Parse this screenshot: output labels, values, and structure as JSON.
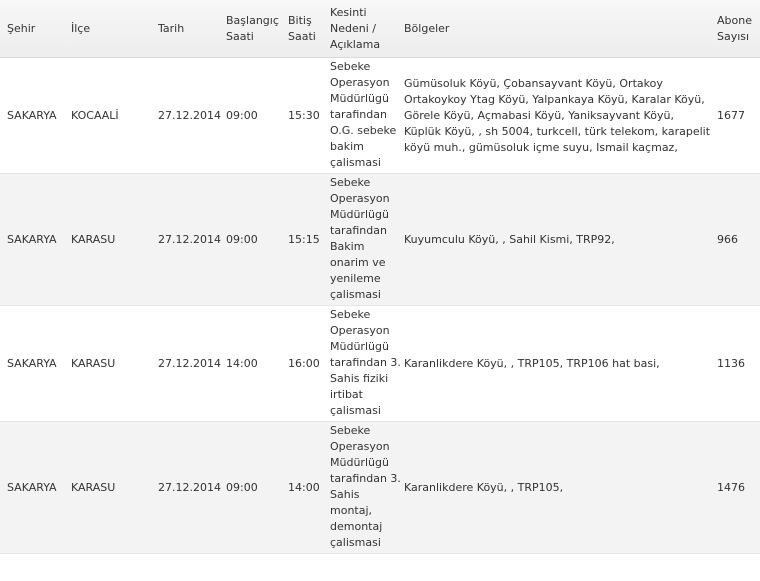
{
  "columns": {
    "city": "Şehir",
    "district": "İlçe",
    "date": "Tarih",
    "start": "Başlangıç Saati",
    "end": "Bitiş Saati",
    "reason": "Kesinti Nedeni / Açıklama",
    "regions": "Bölgeler",
    "subscribers": "Abone Sayısı"
  },
  "rows": [
    {
      "city": "SAKARYA",
      "district": "KOCAALİ",
      "date": "27.12.2014",
      "start": "09:00",
      "end": "15:30",
      "reason": "Sebeke Operasyon Müdürlügü tarafindan O.G. sebeke bakim çalismasi",
      "regions": "Gümüsoluk Köyü, Çobansayvant Köyü, Ortakoy Ortakoykoy Ytag Köyü, Yalpankaya Köyü, Karalar Köyü, Görele Köyü, Açmabasi Köyü, Yaniksayvant Köyü, Küplük Köyü, , sh 5004, turkcell, türk telekom, karapelit köyü muh., gümüsoluk içme suyu, Ismail kaçmaz,",
      "subscribers": "1677"
    },
    {
      "city": "SAKARYA",
      "district": "KARASU",
      "date": "27.12.2014",
      "start": "09:00",
      "end": "15:15",
      "reason": "Sebeke Operasyon Müdürlügü tarafindan Bakim onarim ve yenileme çalismasi",
      "regions": "Kuyumculu Köyü, , Sahil Kismi, TRP92,",
      "subscribers": "966"
    },
    {
      "city": "SAKARYA",
      "district": "KARASU",
      "date": "27.12.2014",
      "start": "14:00",
      "end": "16:00",
      "reason": "Sebeke Operasyon Müdürlügü tarafindan 3. Sahis fiziki irtibat çalismasi",
      "regions": "Karanlikdere Köyü, , TRP105, TRP106 hat basi,",
      "subscribers": "1136"
    },
    {
      "city": "SAKARYA",
      "district": "KARASU",
      "date": "27.12.2014",
      "start": "09:00",
      "end": "14:00",
      "reason": "Sebeke Operasyon Müdürlügü tarafindan 3. Sahis montaj, demontaj çalismasi",
      "regions": "Karanlikdere Köyü, , TRP105,",
      "subscribers": "1476"
    }
  ]
}
